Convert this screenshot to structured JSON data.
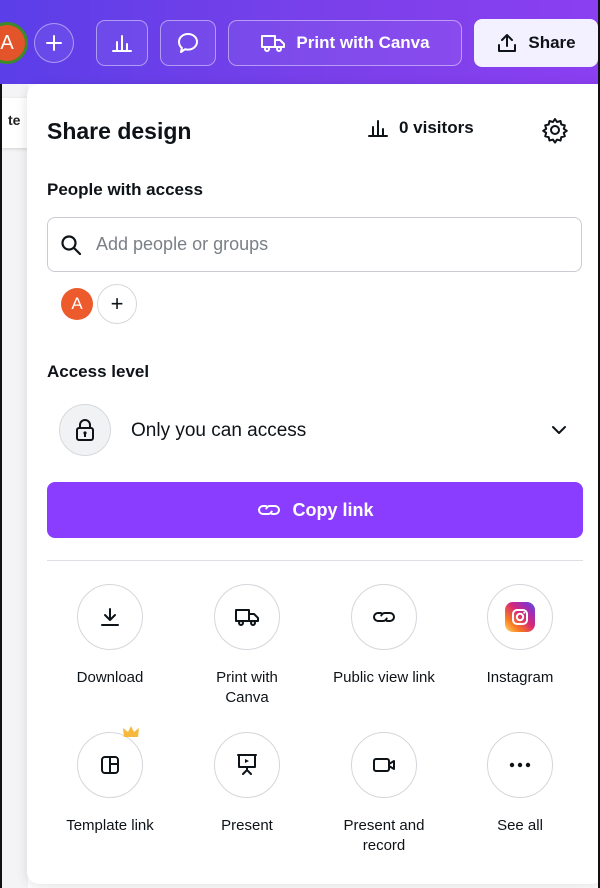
{
  "toolbar": {
    "avatar_initial": "A",
    "print_label": "Print with Canva",
    "share_label": "Share"
  },
  "sidebar": {
    "tab_fragment": "te"
  },
  "panel": {
    "title": "Share design",
    "visitors": "0 visitors",
    "people_heading": "People with access",
    "search_placeholder": "Add people or groups",
    "person_initial": "A",
    "access_heading": "Access level",
    "access_value": "Only you can access",
    "copy_link_label": "Copy link"
  },
  "options": [
    {
      "label": "Download",
      "icon": "download-icon"
    },
    {
      "label": "Print with Canva",
      "icon": "truck-icon"
    },
    {
      "label": "Public view link",
      "icon": "link-icon"
    },
    {
      "label": "Instagram",
      "icon": "instagram-icon"
    },
    {
      "label": "Template link",
      "icon": "template-icon"
    },
    {
      "label": "Present",
      "icon": "present-icon"
    },
    {
      "label": "Present and record",
      "icon": "record-icon"
    },
    {
      "label": "See all",
      "icon": "more-icon"
    }
  ],
  "colors": {
    "accent": "#8b3dff",
    "toolbar_start": "#5b3ee8",
    "toolbar_end": "#8b3ff0",
    "avatar": "#ed5a2c"
  }
}
